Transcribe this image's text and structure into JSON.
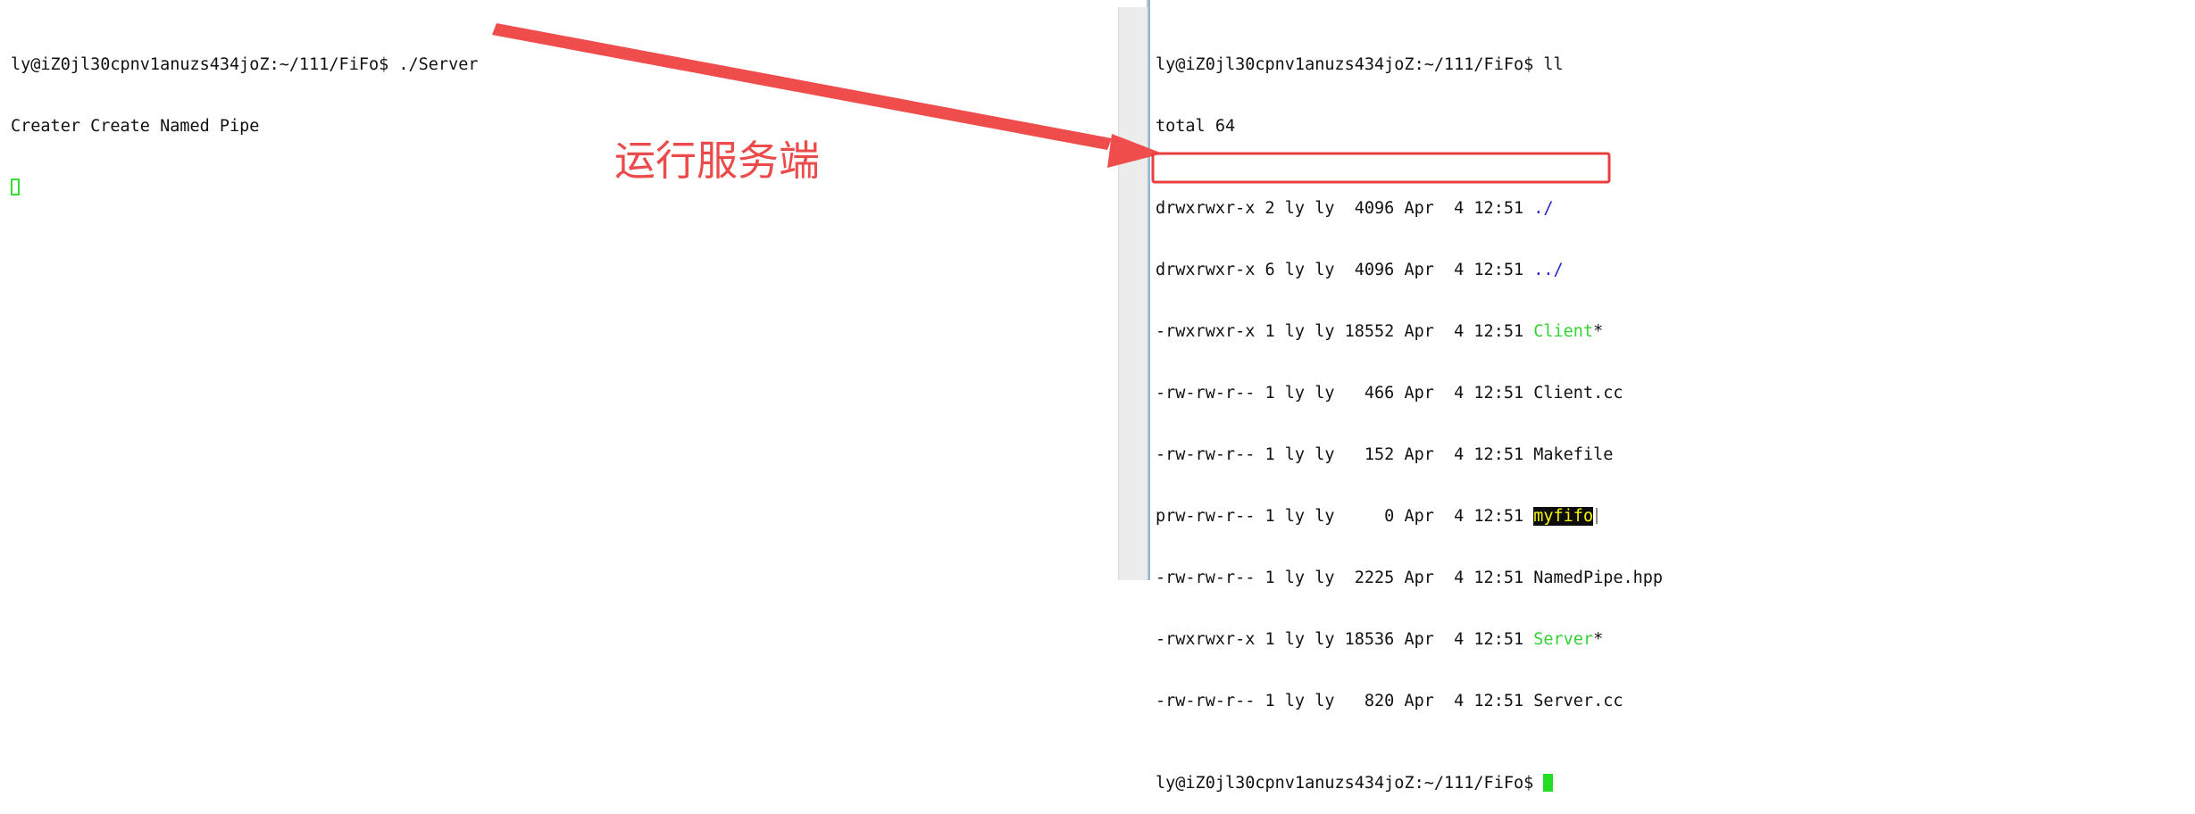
{
  "left_terminal": {
    "lines": [
      "ly@iZ0jl30cpnv1anuzs434joZ:~/111/FiFo$ ./Server",
      "Creater Create Named Pipe"
    ]
  },
  "right_terminal": {
    "prompt_cmd": "ly@iZ0jl30cpnv1anuzs434joZ:~/111/FiFo$ ll",
    "total": "total 64",
    "entries": [
      {
        "meta": "drwxrwxr-x 2 ly ly  4096 Apr  4 12:51 ",
        "name": "./",
        "suffix": ""
      },
      {
        "meta": "drwxrwxr-x 6 ly ly  4096 Apr  4 12:51 ",
        "name": "../",
        "suffix": ""
      },
      {
        "meta": "-rwxrwxr-x 1 ly ly 18552 Apr  4 12:51 ",
        "name": "Client",
        "suffix": "*"
      },
      {
        "meta": "-rw-rw-r-- 1 ly ly   466 Apr  4 12:51 ",
        "name": "Client.cc",
        "suffix": ""
      },
      {
        "meta": "-rw-rw-r-- 1 ly ly   152 Apr  4 12:51 ",
        "name": "Makefile",
        "suffix": ""
      },
      {
        "meta": "prw-rw-r-- 1 ly ly     0 Apr  4 12:51 ",
        "name": "myfifo",
        "suffix": ""
      },
      {
        "meta": "-rw-rw-r-- 1 ly ly  2225 Apr  4 12:51 ",
        "name": "NamedPipe.hpp",
        "suffix": ""
      },
      {
        "meta": "-rwxrwxr-x 1 ly ly 18536 Apr  4 12:51 ",
        "name": "Server",
        "suffix": "*"
      },
      {
        "meta": "-rw-rw-r-- 1 ly ly   820 Apr  4 12:51 ",
        "name": "Server.cc",
        "suffix": ""
      }
    ],
    "final_prompt": "ly@iZ0jl30cpnv1anuzs434joZ:~/111/FiFo$ "
  },
  "annotation": {
    "label": "运行服务端"
  },
  "colors": {
    "annotation_red": "#ec4b4b",
    "executable_green": "#33d133",
    "directory_blue": "#2323c8",
    "fifo_highlight_bg": "#0d0d0d",
    "fifo_highlight_fg": "#f5f500"
  }
}
